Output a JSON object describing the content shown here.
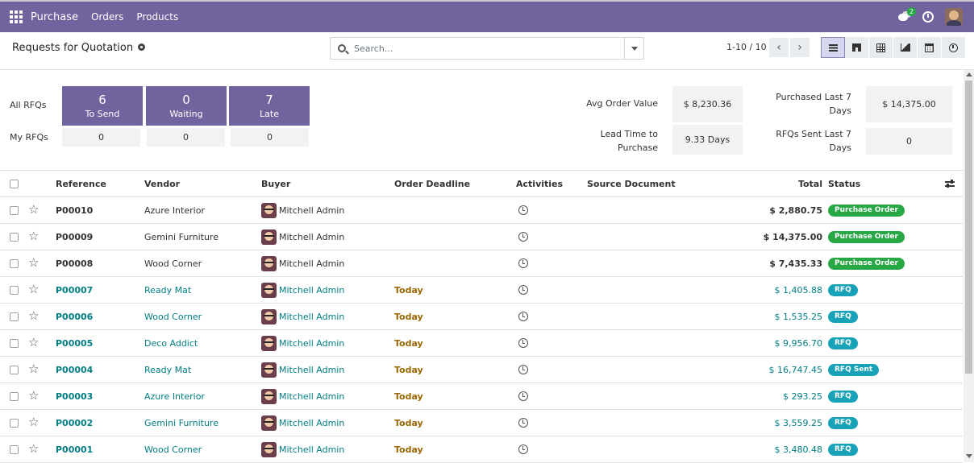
{
  "navbar": {
    "app_name": "Purchase",
    "menu": [
      "Orders",
      "Products"
    ],
    "messages_count": "2"
  },
  "control": {
    "title": "Requests for Quotation",
    "search_placeholder": "Search...",
    "pager": "1-10 / 10",
    "views": [
      "list-icon",
      "kanban-icon",
      "pivot-icon",
      "graph-icon",
      "calendar-icon",
      "activity-icon"
    ]
  },
  "dashboard": {
    "all_rfqs_label": "All RFQs",
    "my_rfqs_label": "My RFQs",
    "tiles": [
      {
        "num": "6",
        "label": "To Send",
        "mine": "0"
      },
      {
        "num": "0",
        "label": "Waiting",
        "mine": "0"
      },
      {
        "num": "7",
        "label": "Late",
        "mine": "0"
      }
    ],
    "avg_order_label": "Avg Order Value",
    "avg_order_value": "$ 8,230.36",
    "lead_time_label_1": "Lead Time to",
    "lead_time_label_2": "Purchase",
    "lead_time_value": "9.33 Days",
    "purchased_label_1": "Purchased Last 7",
    "purchased_label_2": "Days",
    "purchased_value": "$ 14,375.00",
    "rfqs_sent_label_1": "RFQs Sent Last 7",
    "rfqs_sent_label_2": "Days",
    "rfqs_sent_value": "0"
  },
  "table": {
    "headers": {
      "reference": "Reference",
      "vendor": "Vendor",
      "buyer": "Buyer",
      "deadline": "Order Deadline",
      "activities": "Activities",
      "source": "Source Document",
      "total": "Total",
      "status": "Status"
    },
    "rows": [
      {
        "ref": "P00010",
        "vendor": "Azure Interior",
        "buyer": "Mitchell Admin",
        "deadline": "",
        "total": "$ 2,880.75",
        "status": "Purchase Order"
      },
      {
        "ref": "P00009",
        "vendor": "Gemini Furniture",
        "buyer": "Mitchell Admin",
        "deadline": "",
        "total": "$ 14,375.00",
        "status": "Purchase Order"
      },
      {
        "ref": "P00008",
        "vendor": "Wood Corner",
        "buyer": "Mitchell Admin",
        "deadline": "",
        "total": "$ 7,435.33",
        "status": "Purchase Order"
      },
      {
        "ref": "P00007",
        "vendor": "Ready Mat",
        "buyer": "Mitchell Admin",
        "deadline": "Today",
        "total": "$ 1,405.88",
        "status": "RFQ"
      },
      {
        "ref": "P00006",
        "vendor": "Wood Corner",
        "buyer": "Mitchell Admin",
        "deadline": "Today",
        "total": "$ 1,535.25",
        "status": "RFQ"
      },
      {
        "ref": "P00005",
        "vendor": "Deco Addict",
        "buyer": "Mitchell Admin",
        "deadline": "Today",
        "total": "$ 9,956.70",
        "status": "RFQ"
      },
      {
        "ref": "P00004",
        "vendor": "Ready Mat",
        "buyer": "Mitchell Admin",
        "deadline": "Today",
        "total": "$ 16,747.45",
        "status": "RFQ Sent"
      },
      {
        "ref": "P00003",
        "vendor": "Azure Interior",
        "buyer": "Mitchell Admin",
        "deadline": "Today",
        "total": "$ 293.25",
        "status": "RFQ"
      },
      {
        "ref": "P00002",
        "vendor": "Gemini Furniture",
        "buyer": "Mitchell Admin",
        "deadline": "Today",
        "total": "$ 3,559.25",
        "status": "RFQ"
      },
      {
        "ref": "P00001",
        "vendor": "Wood Corner",
        "buyer": "Mitchell Admin",
        "deadline": "Today",
        "total": "$ 3,480.48",
        "status": "RFQ"
      }
    ]
  },
  "colors": {
    "brand": "#71639e",
    "purchase_order_badge": "#28a745",
    "rfq_badge": "#17a2b8",
    "deadline_text": "#9a6700",
    "link_text": "#017e84"
  }
}
